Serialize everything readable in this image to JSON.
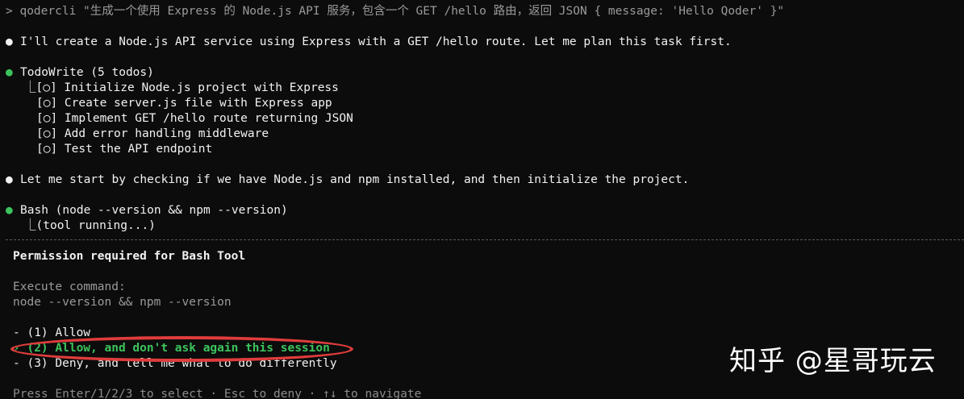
{
  "prompt": {
    "marker": ">",
    "text": "qodercli \"生成一个使用 Express 的 Node.js API 服务，包含一个 GET /hello 路由，返回 JSON { message: 'Hello Qoder' }\""
  },
  "messages": {
    "intro": "I'll create a Node.js API service using Express with a GET /hello route. Let me plan this task first.",
    "todo_header": "TodoWrite (5 todos)",
    "todos": [
      "[○] Initialize Node.js project with Express",
      "[○] Create server.js file with Express app",
      "[○] Implement GET /hello route returning JSON",
      "[○] Add error handling middleware",
      "[○] Test the API endpoint"
    ],
    "check": "Let me start by checking if we have Node.js and npm installed, and then initialize the project.",
    "bash_header": "Bash (node --version && npm --version)",
    "bash_status": "(tool running...)"
  },
  "bullets": {
    "white": "●",
    "green": "●",
    "branch": "⎿"
  },
  "permission": {
    "title": "Permission required for Bash Tool",
    "execute_label": "Execute command:",
    "command": "node --version && npm --version",
    "options": [
      "- (1) Allow",
      "› (2) Allow, and don't ask again this session",
      "- (3) Deny, and tell me what to do differently"
    ],
    "footer": "Press Enter/1/2/3 to select · Esc to deny · ↑↓ to navigate"
  },
  "watermark": "知乎 @星哥玩云",
  "colors": {
    "green": "#3cc35c",
    "highlight": "#e03c3c",
    "background": "#0c0c0c"
  }
}
